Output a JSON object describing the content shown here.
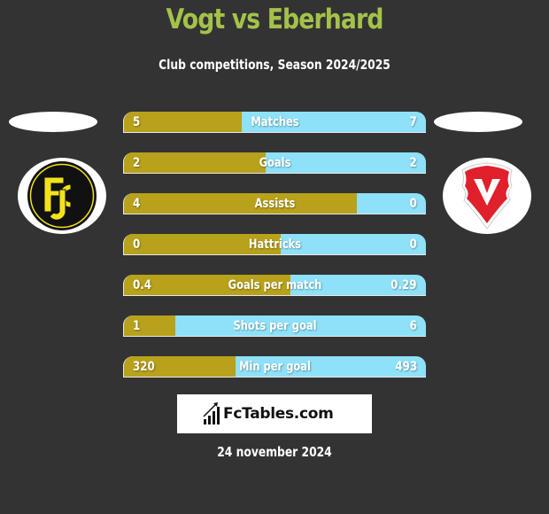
{
  "header": {
    "title": "Vogt vs Eberhard",
    "subtitle": "Club competitions, Season 2024/2025"
  },
  "players": {
    "left": {
      "name": "Vogt",
      "club_logo": "fc-schaffhausen-logo"
    },
    "right": {
      "name": "Eberhard",
      "club_logo": "fc-vaduz-logo"
    }
  },
  "colors": {
    "background": "#333333",
    "title": "#a4c24a",
    "left_bar": "#b8a11b",
    "right_bar": "#8ee1f8",
    "text": "#ffffff"
  },
  "stats": [
    {
      "label": "Matches",
      "left": "5",
      "right": "7",
      "left_fill": 0.39
    },
    {
      "label": "Goals",
      "left": "2",
      "right": "2",
      "left_fill": 0.47
    },
    {
      "label": "Assists",
      "left": "4",
      "right": "0",
      "left_fill": 0.77
    },
    {
      "label": "Hattricks",
      "left": "0",
      "right": "0",
      "left_fill": 0.52
    },
    {
      "label": "Goals per match",
      "left": "0.4",
      "right": "0.29",
      "left_fill": 0.55
    },
    {
      "label": "Shots per goal",
      "left": "1",
      "right": "6",
      "left_fill": 0.17
    },
    {
      "label": "Min per goal",
      "left": "320",
      "right": "493",
      "left_fill": 0.37
    }
  ],
  "brand": {
    "name": "FcTables.com",
    "icon": "bar-chart-icon"
  },
  "footer": {
    "date": "24 november 2024"
  }
}
